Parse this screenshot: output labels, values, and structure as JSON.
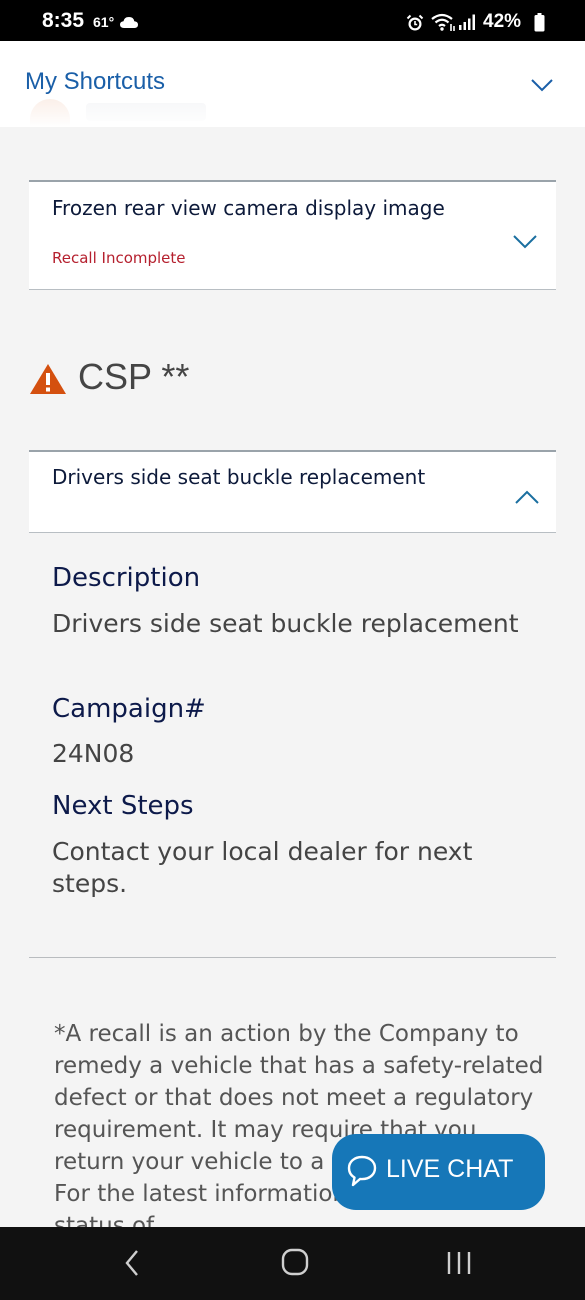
{
  "status_bar": {
    "time": "8:35",
    "temperature": "61°",
    "battery": "42%",
    "icons": [
      "cloud-icon",
      "alarm-icon",
      "wifi-icon",
      "signal-icon",
      "battery-icon"
    ]
  },
  "header": {
    "title": "My Shortcuts",
    "toggle_icon": "chevron-down-icon"
  },
  "recall_card": {
    "title": "Frozen rear view camera display image",
    "status": "Recall Incomplete",
    "toggle_icon": "chevron-down-icon"
  },
  "csp": {
    "heading": "CSP **",
    "icon": "warning-icon"
  },
  "csp_card": {
    "title": "Drivers side seat buckle replacement",
    "toggle_icon": "chevron-up-icon"
  },
  "details": {
    "description_label": "Description",
    "description_value": "Drivers side seat buckle replacement",
    "campaign_label": "Campaign#",
    "campaign_value": "24N08",
    "next_steps_label": "Next Steps",
    "next_steps_value": "Contact your local dealer for next steps."
  },
  "footnote": "*A recall is an action by the Company to remedy a vehicle that has a safety-related defect or that does not meet a regulatory requirement. It may require that you return your vehicle to a dealer for service. For the latest information regarding the status of",
  "live_chat": {
    "label": "LIVE CHAT",
    "icon": "chat-bubble-icon"
  },
  "colors": {
    "brand_blue": "#1a5fa8",
    "chat_blue": "#1677b8",
    "recall_red": "#b5202e",
    "warning_orange": "#d4500f",
    "navy_text": "#0d1a4a"
  }
}
